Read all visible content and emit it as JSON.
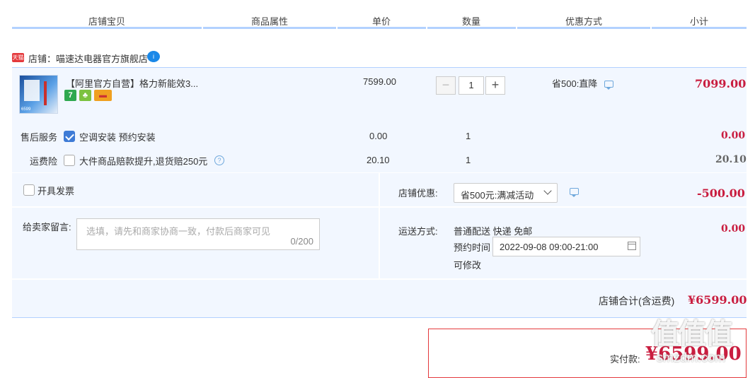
{
  "header": {
    "cols": [
      "店铺宝贝",
      "商品属性",
      "单价",
      "数量",
      "优惠方式",
      "小计"
    ]
  },
  "shop": {
    "tmall_badge": "天猫",
    "name": "店铺：喵速达电器官方旗舰店",
    "ww_glyph": "i"
  },
  "item": {
    "title": "【阿里官方自营】格力新能效3...",
    "badges": [
      "7",
      "♣",
      "▬"
    ],
    "thumb_text": "6599",
    "price": "7599.00",
    "qty_minus": "−",
    "qty": "1",
    "qty_plus": "+",
    "promo": "省500:直降",
    "subtotal": "7099.00"
  },
  "service": {
    "label": "售后服务",
    "option": "空调安装 预约安装",
    "price": "0.00",
    "qty": "1",
    "subtotal": "0.00"
  },
  "freight_ins": {
    "label": "运费险",
    "option": "大件商品赔款提升,退货赔250元",
    "help": "?",
    "price": "20.10",
    "qty": "1",
    "subtotal": "20.10"
  },
  "invoice": {
    "label": "开具发票"
  },
  "shop_discount": {
    "label": "店铺优惠:",
    "selected": "省500元:满减活动",
    "amount": "-500.00"
  },
  "message": {
    "label": "给卖家留言:",
    "placeholder": "选填，请先和商家协商一致，付款后商家可见",
    "counter": "0/200"
  },
  "shipping": {
    "label": "运送方式:",
    "method": "普通配送 快递 免邮",
    "appoint_label": "预约时间",
    "appoint_value": "2022-09-08 09:00-21:00",
    "modifiable": "可修改",
    "fee": "0.00"
  },
  "shop_total": {
    "label": "店铺合计(含运费)",
    "value": "¥6599.00"
  },
  "payment": {
    "label": "实付款:",
    "value": "¥6599.00"
  },
  "watermark": {
    "logo": "值值值",
    "url": "smzdm.com"
  },
  "colors": {
    "price_red": "#c91d3f",
    "row_bg": "#f2f7ff",
    "accent_blue": "#3e7bd6",
    "header_line": "#b2d1ff"
  }
}
